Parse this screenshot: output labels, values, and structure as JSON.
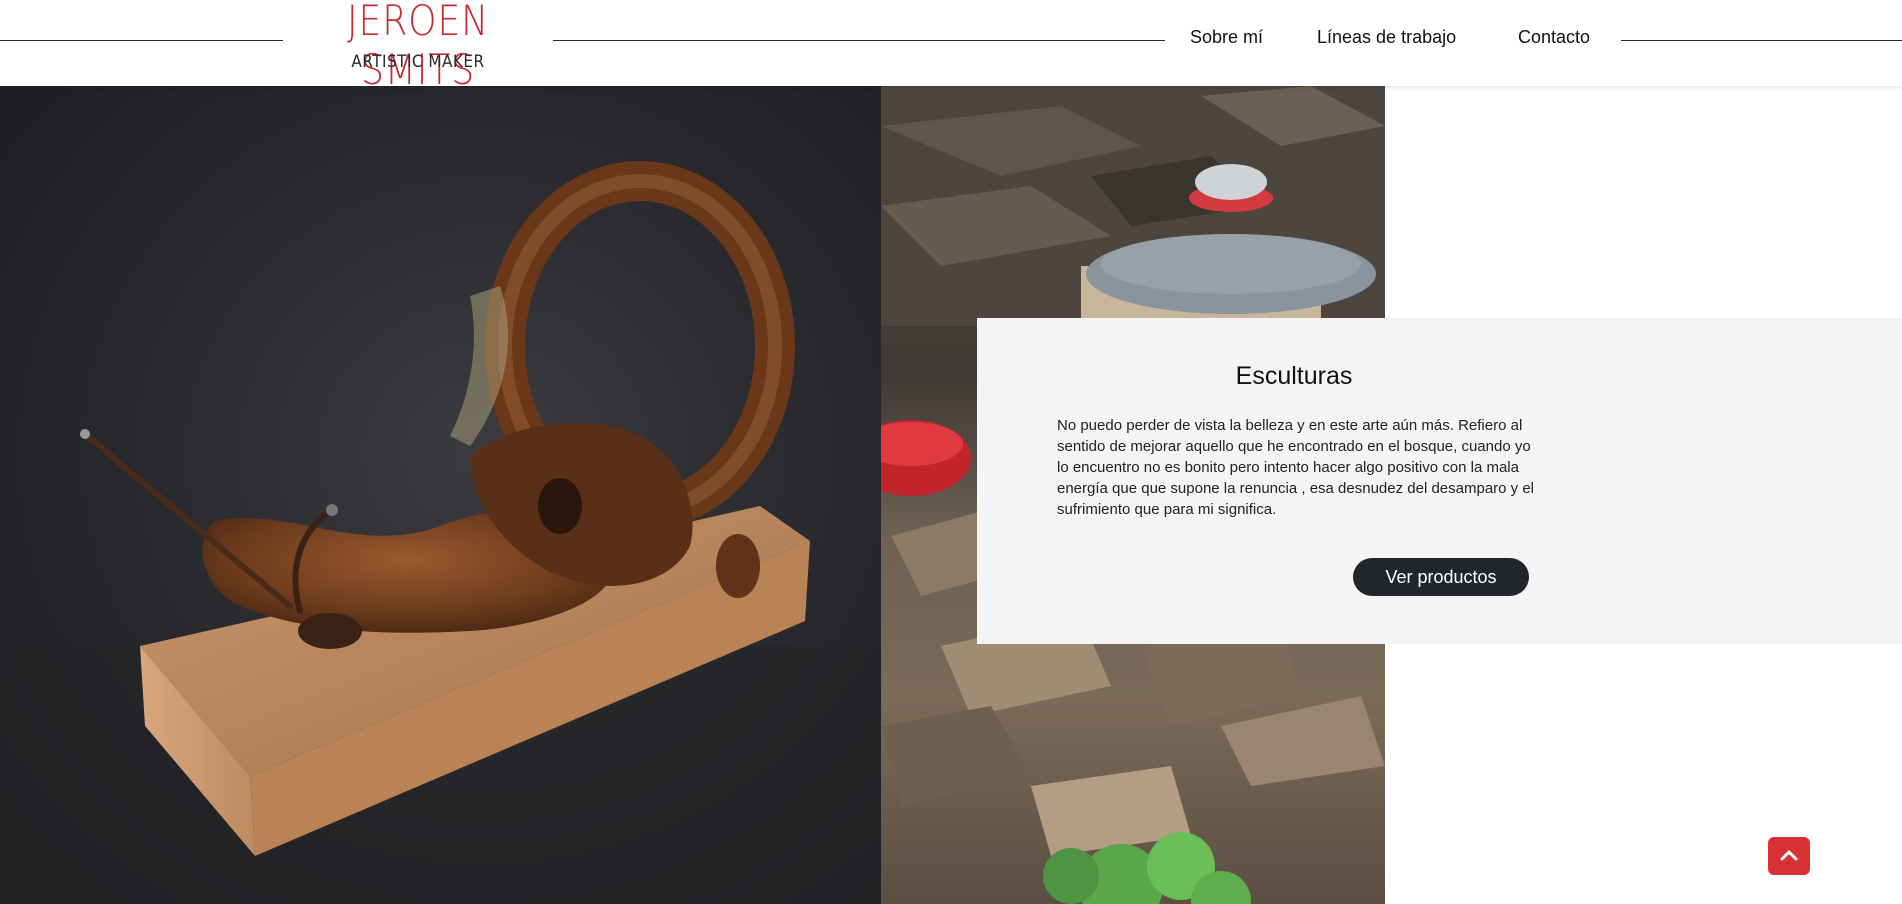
{
  "header": {
    "logo_name": "JEROEN SMITS",
    "logo_tagline": "ARTISTIC MAKER",
    "nav": [
      "Sobre mí",
      "Líneas de trabajo",
      "Contacto"
    ]
  },
  "card": {
    "title": "Esculturas",
    "text": "No puedo perder de vista la belleza y en este arte aún más. Refiero al sentido de mejorar aquello que he encontrado en el bosque, cuando yo lo encuentro no es bonito pero intento hacer algo positivo con la mala energía que que supone la renuncia , esa desnudez del desamparo y el sufrimiento que para mi significa.",
    "button": "Ver productos"
  },
  "colors": {
    "brand_red": "#c52b31",
    "button_dark": "#22262b",
    "card_bg": "#f4f4f4",
    "scroll_button": "#d93033"
  },
  "icons": {
    "scroll_top": "chevron-up-icon"
  }
}
